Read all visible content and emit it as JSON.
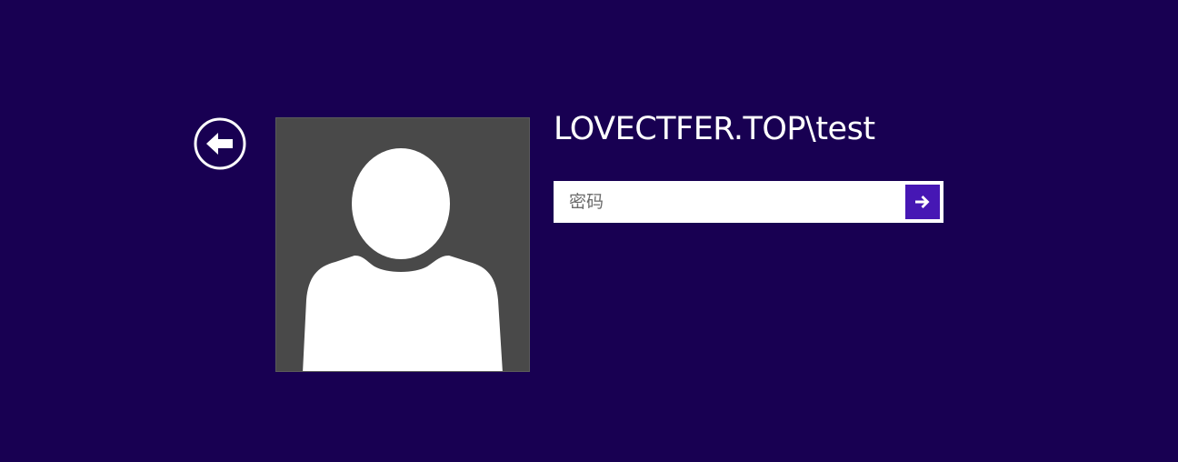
{
  "login": {
    "username": "LOVECTFER.TOP\\test",
    "password_placeholder": "密码",
    "password_value": ""
  },
  "icons": {
    "back": "back-arrow-circle-icon",
    "avatar": "default-user-avatar-icon",
    "submit": "arrow-right-icon"
  },
  "colors": {
    "background": "#180052",
    "avatar_background": "#494949",
    "submit_button": "#4617b4",
    "text": "#ffffff"
  }
}
